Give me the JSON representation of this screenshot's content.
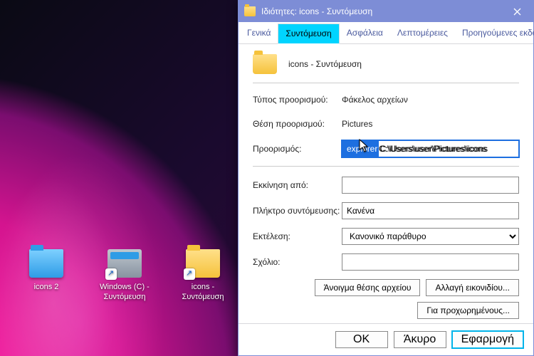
{
  "desktop": {
    "icons": [
      {
        "label": "icons 2"
      },
      {
        "label": "Windows (C) - Συντόμευση"
      },
      {
        "label": "icons - Συντόμευση"
      }
    ]
  },
  "dialog": {
    "title": "Ιδιότητες: icons - Συντόμευση",
    "tabs": {
      "general": "Γενικά",
      "shortcut": "Συντόμευση",
      "security": "Ασφάλεια",
      "details": "Λεπτομέρειες",
      "previous": "Προηγούμενες εκδόσεις"
    },
    "header_name": "icons - Συντόμευση",
    "labels": {
      "target_type": "Τύπος προορισμού:",
      "target_location": "Θέση προορισμού:",
      "target": "Προορισμός:",
      "start_in": "Εκκίνηση από:",
      "shortcut_key": "Πλήκτρο συντόμευσης:",
      "run": "Εκτέλεση:",
      "comment": "Σχόλιο:"
    },
    "values": {
      "target_type": "Φάκελος αρχείων",
      "target_location": "Pictures",
      "target_selected": "explorer",
      "target_rest": " C:\\Users\\user\\Pictures\\icons",
      "target_full": "explorer C:\\Users\\user\\Pictures\\icons",
      "start_in": "",
      "shortcut_key": "Κανένα",
      "run": "Κανονικό παράθυρο",
      "comment": ""
    },
    "buttons": {
      "open_location": "Άνοιγμα θέσης αρχείου",
      "change_icon": "Αλλαγή εικονιδίου...",
      "advanced": "Για προχωρημένους...",
      "ok": "OK",
      "cancel": "Άκυρο",
      "apply": "Εφαρμογή"
    }
  }
}
